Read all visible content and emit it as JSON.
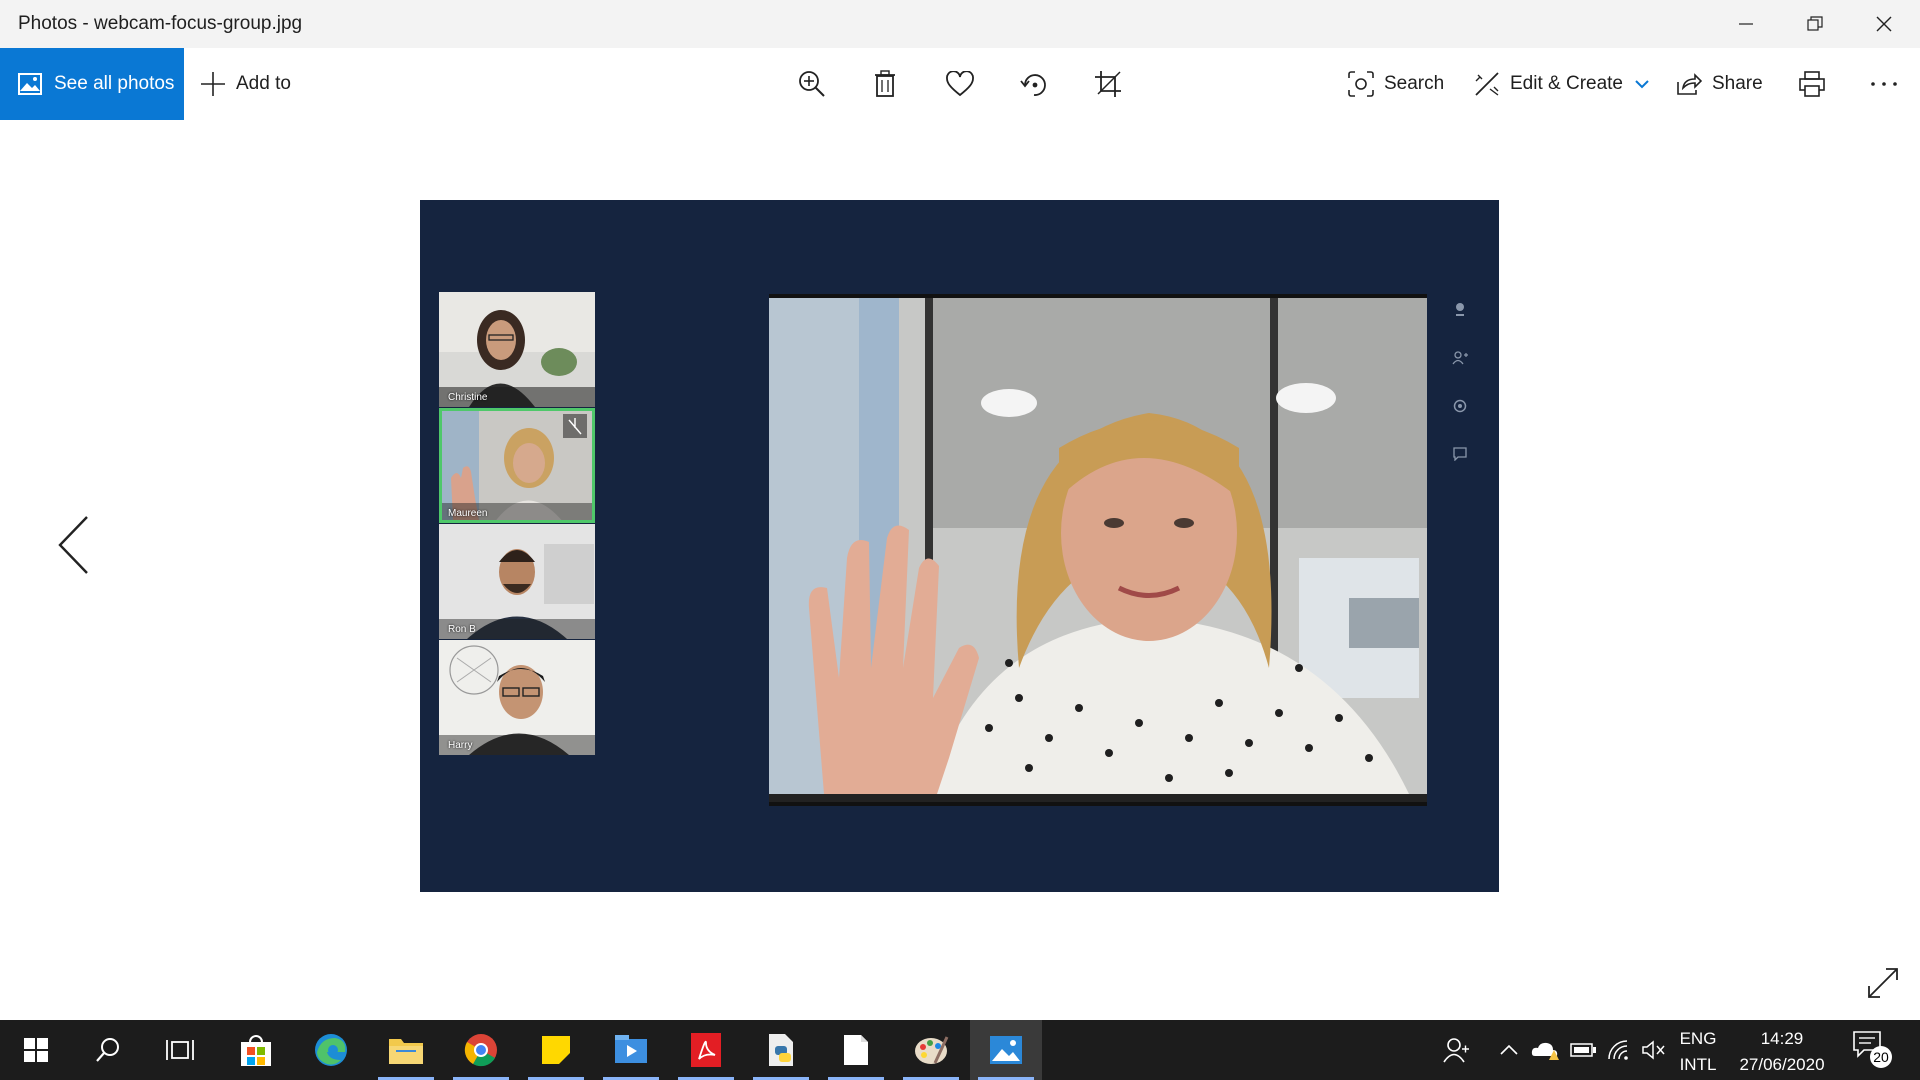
{
  "window": {
    "title": "Photos - webcam-focus-group.jpg"
  },
  "toolbar": {
    "see_all_photos": "See all photos",
    "add_to": "Add to",
    "search": "Search",
    "edit_create": "Edit & Create",
    "share": "Share"
  },
  "photo": {
    "participants": [
      {
        "name": "Christine"
      },
      {
        "name": "Maureen"
      },
      {
        "name": "Ron B"
      },
      {
        "name": "Harry"
      }
    ]
  },
  "taskbar": {
    "lang": "ENG",
    "layout": "INTL",
    "time": "14:29",
    "date": "27/06/2020",
    "notifications": "20"
  },
  "colors": {
    "accent": "#0a78d4",
    "photo_bg": "#15243f",
    "taskbar": "#1c1c1c",
    "active_thumb_border": "#4fc86a"
  }
}
